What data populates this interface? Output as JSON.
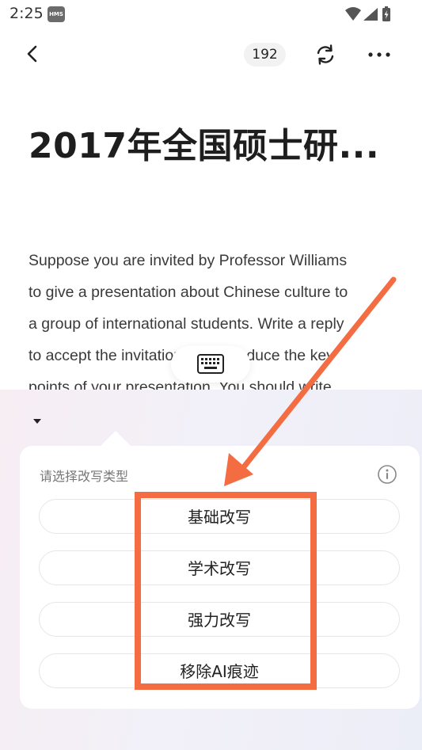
{
  "status_bar": {
    "time": "2:25",
    "badge": "HMS",
    "icons": [
      "wifi-icon",
      "signal-icon",
      "battery-charging-icon"
    ]
  },
  "toolbar": {
    "back_icon": "chevron-left-icon",
    "page_count": "192",
    "refresh_icon": "refresh-icon",
    "more_icon": "more-horizontal-icon"
  },
  "document": {
    "title": "2017年全国硕士研...",
    "body_lines": [
      "Suppose you are invited by Professor Williams",
      "to give a presentation about Chinese culture to",
      "a group of international students. Write a reply",
      "to accept the invitation and introduce the key",
      "points of your presentation. You should write"
    ]
  },
  "keyboard_toggle": {
    "icon": "keyboard-icon"
  },
  "rewrite_panel": {
    "collapse_icon": "caret-down-icon",
    "title": "请选择改写类型",
    "info_icon": "info-icon",
    "options": [
      {
        "label": "基础改写"
      },
      {
        "label": "学术改写"
      },
      {
        "label": "强力改写"
      },
      {
        "label": "移除AI痕迹"
      }
    ]
  },
  "annotation": {
    "color": "#f36c42"
  }
}
